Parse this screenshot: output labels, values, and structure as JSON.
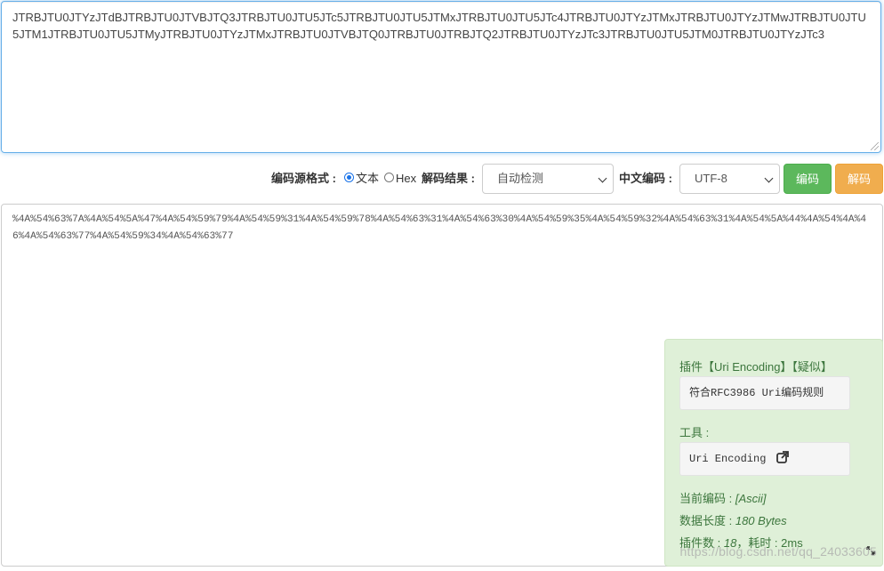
{
  "input": {
    "text": "JTRBJTU0JTYzJTdBJTRBJTU0JTVBJTQ3JTRBJTU0JTU5JTc5JTRBJTU0JTU5JTMxJTRBJTU0JTU5JTc4JTRBJTU0JTYzJTMxJTRBJTU0JTYzJTMwJTRBJTU0JTU5JTM1JTRBJTU0JTU5JTMyJTRBJTU0JTYzJTMxJTRBJTU0JTVBJTQ0JTRBJTU0JTRBJTQ2JTRBJTU0JTYzJTc3JTRBJTU0JTU5JTM0JTRBJTU0JTYzJTc3"
  },
  "toolbar": {
    "source_format_label": "编码源格式 :",
    "radio_text_label": "文本",
    "radio_hex_label": "Hex",
    "decode_result_label": "解码结果 :",
    "decode_result_value": "自动检测",
    "chinese_encoding_label": "中文编码 :",
    "chinese_encoding_value": "UTF-8",
    "encode_button": "编码",
    "decode_button": "解码"
  },
  "output": {
    "text": "%4A%54%63%7A%4A%54%5A%47%4A%54%59%79%4A%54%59%31%4A%54%59%78%4A%54%63%31%4A%54%63%30%4A%54%59%35%4A%54%59%32%4A%54%63%31%4A%54%5A%44%4A%54%4A%46%4A%54%63%77%4A%54%59%34%4A%54%63%77"
  },
  "plugin_panel": {
    "title": "插件【Uri Encoding】【疑似】",
    "rule_text": "符合RFC3986 Uri编码规则",
    "tool_label": "工具 :",
    "tool_name": "Uri Encoding",
    "current_encoding_label": "当前编码 : ",
    "current_encoding_value": "[Ascii]",
    "data_length_label": "数据长度 : ",
    "data_length_value": "180 Bytes",
    "plugin_count_label": "插件数 : ",
    "plugin_count_value": "18",
    "time_label": "，耗时 : ",
    "time_value": "2ms",
    "external_link_icon": "external-link-icon",
    "expand_icon": "expand-icon",
    "panel_bg": "#dff0d8",
    "panel_text": "#3c763d"
  },
  "watermark": "https://blog.csdn.net/qq_24033605",
  "colors": {
    "encode_button": "#5cb85c",
    "decode_button": "#f0ad4e",
    "focus_border": "#66afe9"
  }
}
